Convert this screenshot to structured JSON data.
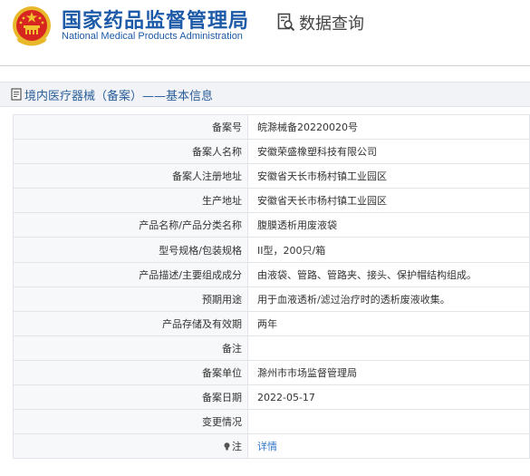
{
  "header": {
    "org_name_cn": "国家药品监督管理局",
    "org_name_en": "National Medical Products Administration",
    "query_title": "数据查询"
  },
  "section": {
    "title": "境内医疗器械（备案）——基本信息"
  },
  "rows": [
    {
      "label": "备案号",
      "value": "皖滁械备20220020号"
    },
    {
      "label": "备案人名称",
      "value": "安徽荣盛橡塑科技有限公司"
    },
    {
      "label": "备案人注册地址",
      "value": "安徽省天长市杨村镇工业园区"
    },
    {
      "label": "生产地址",
      "value": "安徽省天长市杨村镇工业园区"
    },
    {
      "label": "产品名称/产品分类名称",
      "value": "腹膜透析用废液袋"
    },
    {
      "label": "型号规格/包装规格",
      "value": "II型，200只/箱"
    },
    {
      "label": "产品描述/主要组成成分",
      "value": "由液袋、管路、管路夹、接头、保护帽结构组成。"
    },
    {
      "label": "预期用途",
      "value": "用于血液透析/滤过治疗时的透析废液收集。"
    },
    {
      "label": "产品存储及有效期",
      "value": "两年"
    },
    {
      "label": "备注",
      "value": ""
    },
    {
      "label": "备案单位",
      "value": "滁州市市场监督管理局"
    },
    {
      "label": "备案日期",
      "value": "2022-05-17"
    },
    {
      "label": "变更情况",
      "value": ""
    },
    {
      "label": "注",
      "value": "详情"
    }
  ],
  "colors": {
    "brand_blue": "#1d5aa8",
    "link_blue": "#2f75c8",
    "emblem_red": "#d6261f",
    "emblem_gold": "#f2c230"
  },
  "icons": [
    "national-emblem-icon",
    "search-document-icon",
    "document-icon",
    "lightbulb-icon"
  ]
}
